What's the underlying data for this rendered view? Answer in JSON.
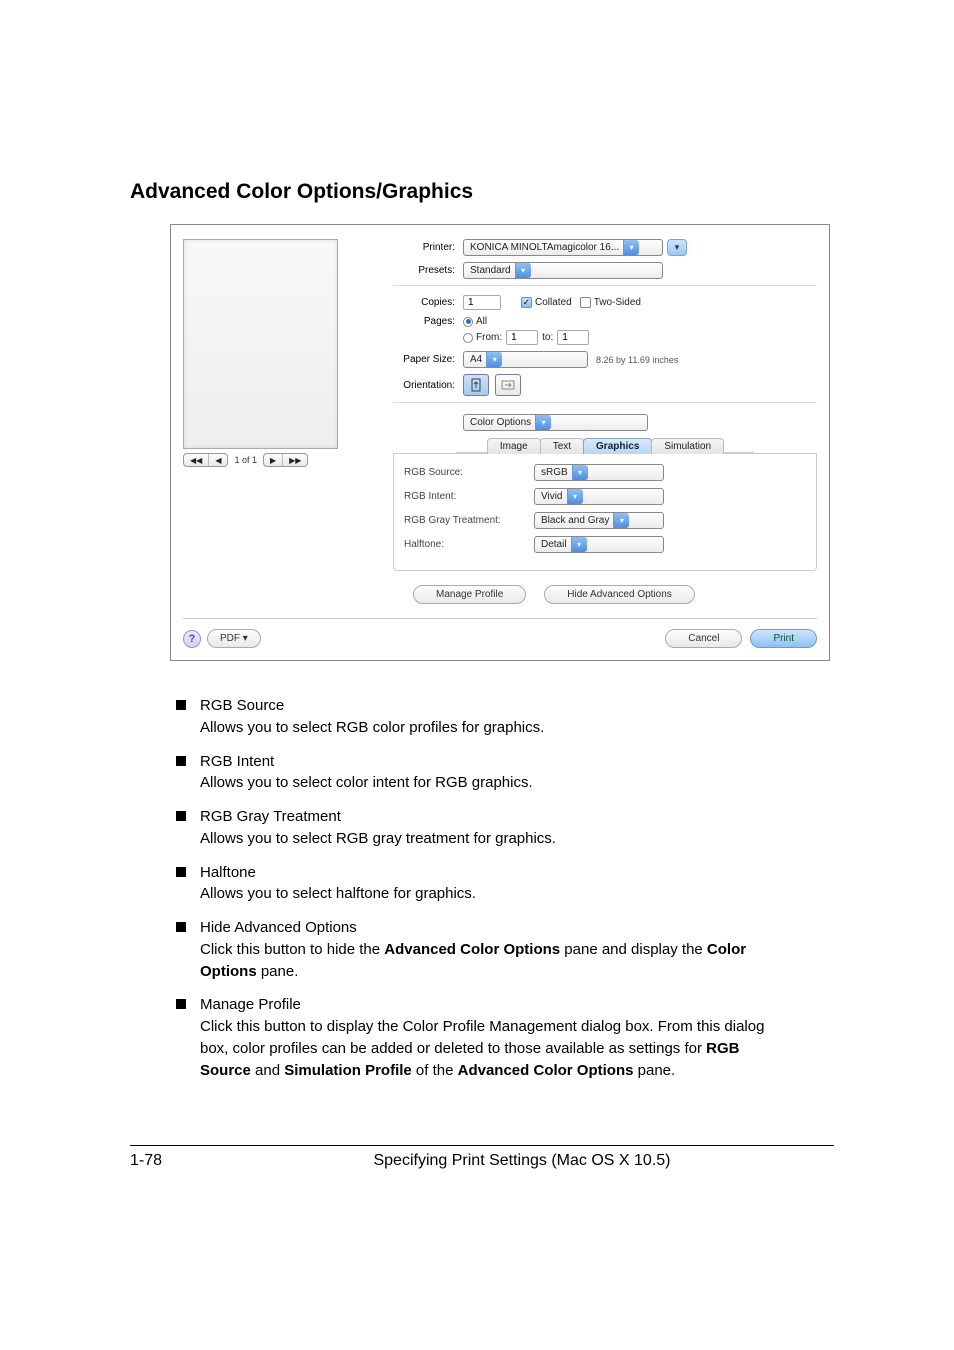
{
  "heading": "Advanced Color Options/Graphics",
  "dialog": {
    "labels": {
      "printer": "Printer:",
      "presets": "Presets:",
      "copies": "Copies:",
      "pages": "Pages:",
      "all": "All",
      "from": "From:",
      "to": "to:",
      "paper_size": "Paper Size:",
      "orientation": "Orientation:",
      "paper_dim": "8.26 by 11.69 inches"
    },
    "values": {
      "printer": "KONICA MINOLTAmagicolor 16...",
      "presets": "Standard",
      "copies": "1",
      "from": "1",
      "to": "1",
      "paper_size": "A4",
      "section": "Color Options"
    },
    "checks": {
      "collated": "Collated",
      "two_sided": "Two-Sided"
    },
    "tabs": {
      "image": "Image",
      "text": "Text",
      "graphics": "Graphics",
      "simulation": "Simulation"
    },
    "options": {
      "rgb_source_l": "RGB Source:",
      "rgb_source_v": "sRGB",
      "rgb_intent_l": "RGB Intent:",
      "rgb_intent_v": "Vivid",
      "rgb_gray_l": "RGB Gray Treatment:",
      "rgb_gray_v": "Black and Gray",
      "halftone_l": "Halftone:",
      "halftone_v": "Detail"
    },
    "buttons": {
      "manage_profile": "Manage Profile",
      "hide_adv": "Hide Advanced Options",
      "pdf": "PDF ▾",
      "cancel": "Cancel",
      "print": "Print"
    },
    "preview": {
      "first": "◀◀",
      "prev": "◀",
      "page": "1 of 1",
      "next": "▶",
      "last": "▶▶"
    }
  },
  "bullets": {
    "b1t": "RGB Source",
    "b1d": "Allows you to select RGB color profiles for graphics.",
    "b2t": "RGB Intent",
    "b2d": "Allows you to select color intent for RGB graphics.",
    "b3t": "RGB Gray Treatment",
    "b3d": "Allows you to select RGB gray treatment for graphics.",
    "b4t": "Halftone",
    "b4d": "Allows you to select halftone for graphics.",
    "b5t": "Hide Advanced Options",
    "b5d1": "Click this button to hide the ",
    "b5b1": "Advanced Color Options",
    "b5d2": " pane and display the ",
    "b5b2": "Color Options",
    "b5d3": " pane.",
    "b6t": "Manage Profile",
    "b6d1": "Click this button to display the Color Profile Management dialog box. From this dialog box, color profiles can be added or deleted to those available as settings for ",
    "b6b1": "RGB Source",
    "b6d2": " and ",
    "b6b2": "Simulation Profile",
    "b6d3": " of the ",
    "b6b3": "Advanced Color Options",
    "b6d4": " pane."
  },
  "footer": {
    "page": "1-78",
    "section": "Specifying Print Settings (Mac OS X 10.5)"
  }
}
